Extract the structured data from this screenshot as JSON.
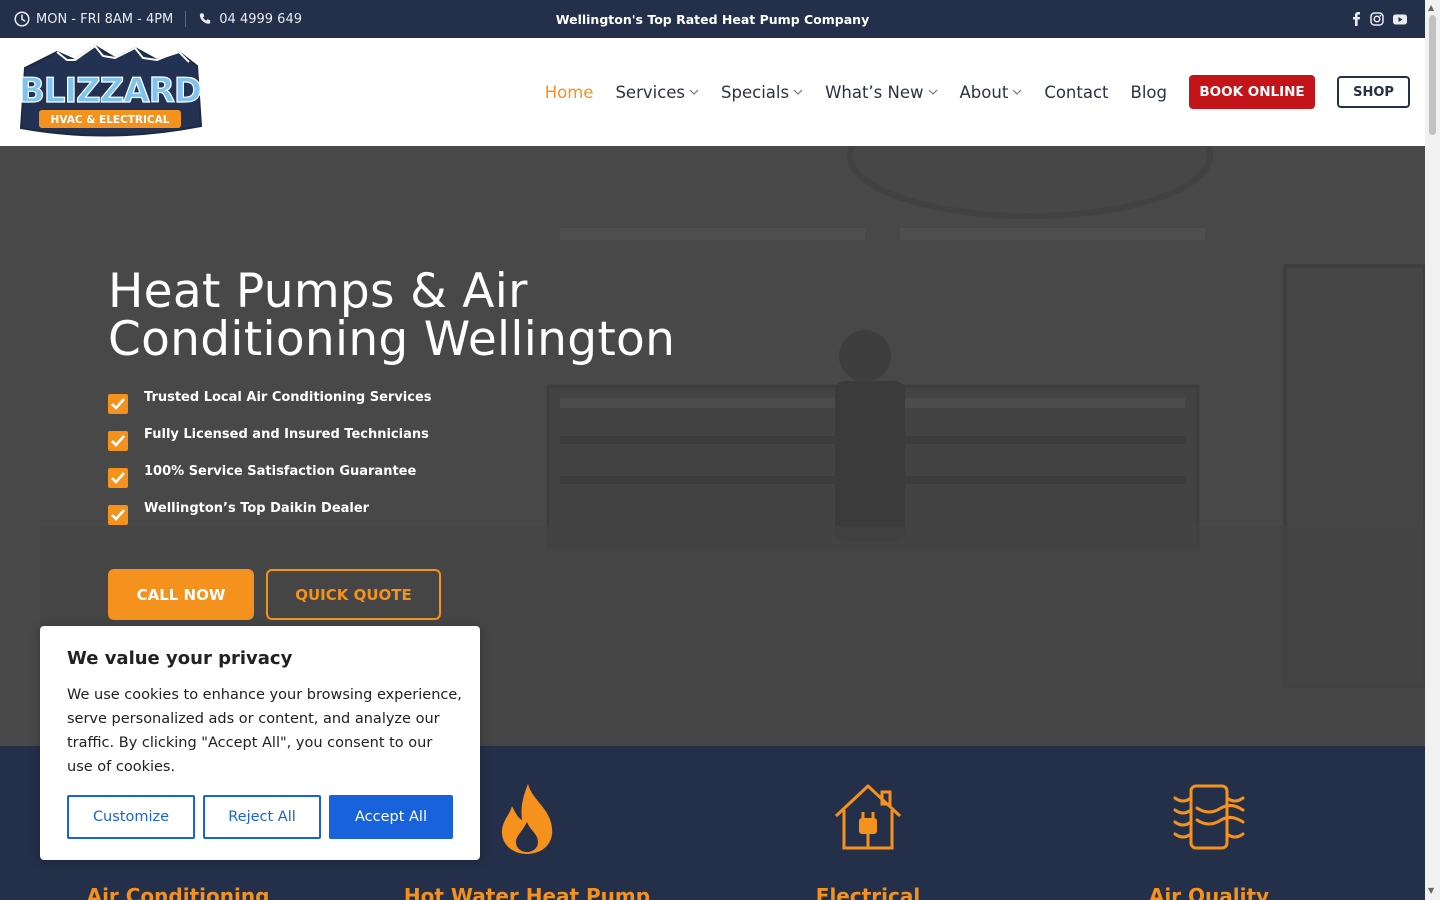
{
  "topbar": {
    "hours": "MON - FRI 8AM - 4PM",
    "phone": "04 4999 649",
    "tagline": "Wellington's Top Rated Heat Pump Company",
    "social": [
      "facebook-icon",
      "instagram-icon",
      "youtube-icon"
    ]
  },
  "header": {
    "logo_text": "BLIZZARD",
    "logo_subtext": "HVAC & ELECTRICAL",
    "nav": [
      {
        "label": "Home",
        "dropdown": false,
        "active": true
      },
      {
        "label": "Services",
        "dropdown": true
      },
      {
        "label": "Specials",
        "dropdown": true
      },
      {
        "label": "What’s New",
        "dropdown": true
      },
      {
        "label": "About",
        "dropdown": true
      },
      {
        "label": "Contact",
        "dropdown": false
      },
      {
        "label": "Blog",
        "dropdown": false
      }
    ],
    "book_label": "BOOK ONLINE",
    "shop_label": "SHOP"
  },
  "hero": {
    "title_line1": "Heat Pumps & Air",
    "title_line2": "Conditioning Wellington",
    "checks": [
      "Trusted Local Air Conditioning Services",
      "Fully Licensed and Insured Technicians",
      "100% Service Satisfaction Guarantee",
      "Wellington’s Top Daikin Dealer"
    ],
    "call_label": "CALL NOW",
    "quote_label": "QUICK QUOTE"
  },
  "services": [
    {
      "title": "Air Conditioning",
      "icon": "snowflake-icon"
    },
    {
      "title": "Hot Water Heat Pump",
      "icon": "flame-icon"
    },
    {
      "title": "Electrical",
      "icon": "house-plug-icon"
    },
    {
      "title": "Air Quality",
      "icon": "air-flow-icon"
    }
  ],
  "cookie": {
    "title": "We value your privacy",
    "body": "We use cookies to enhance your browsing experience, serve personalized ads or content, and analyze our traffic. By clicking \"Accept All\", you consent to our use of cookies.",
    "customize": "Customize",
    "reject": "Reject All",
    "accept": "Accept All"
  },
  "colors": {
    "navy": "#243049",
    "orange": "#f5921e",
    "red": "#c3141a",
    "blue": "#1863dc"
  }
}
